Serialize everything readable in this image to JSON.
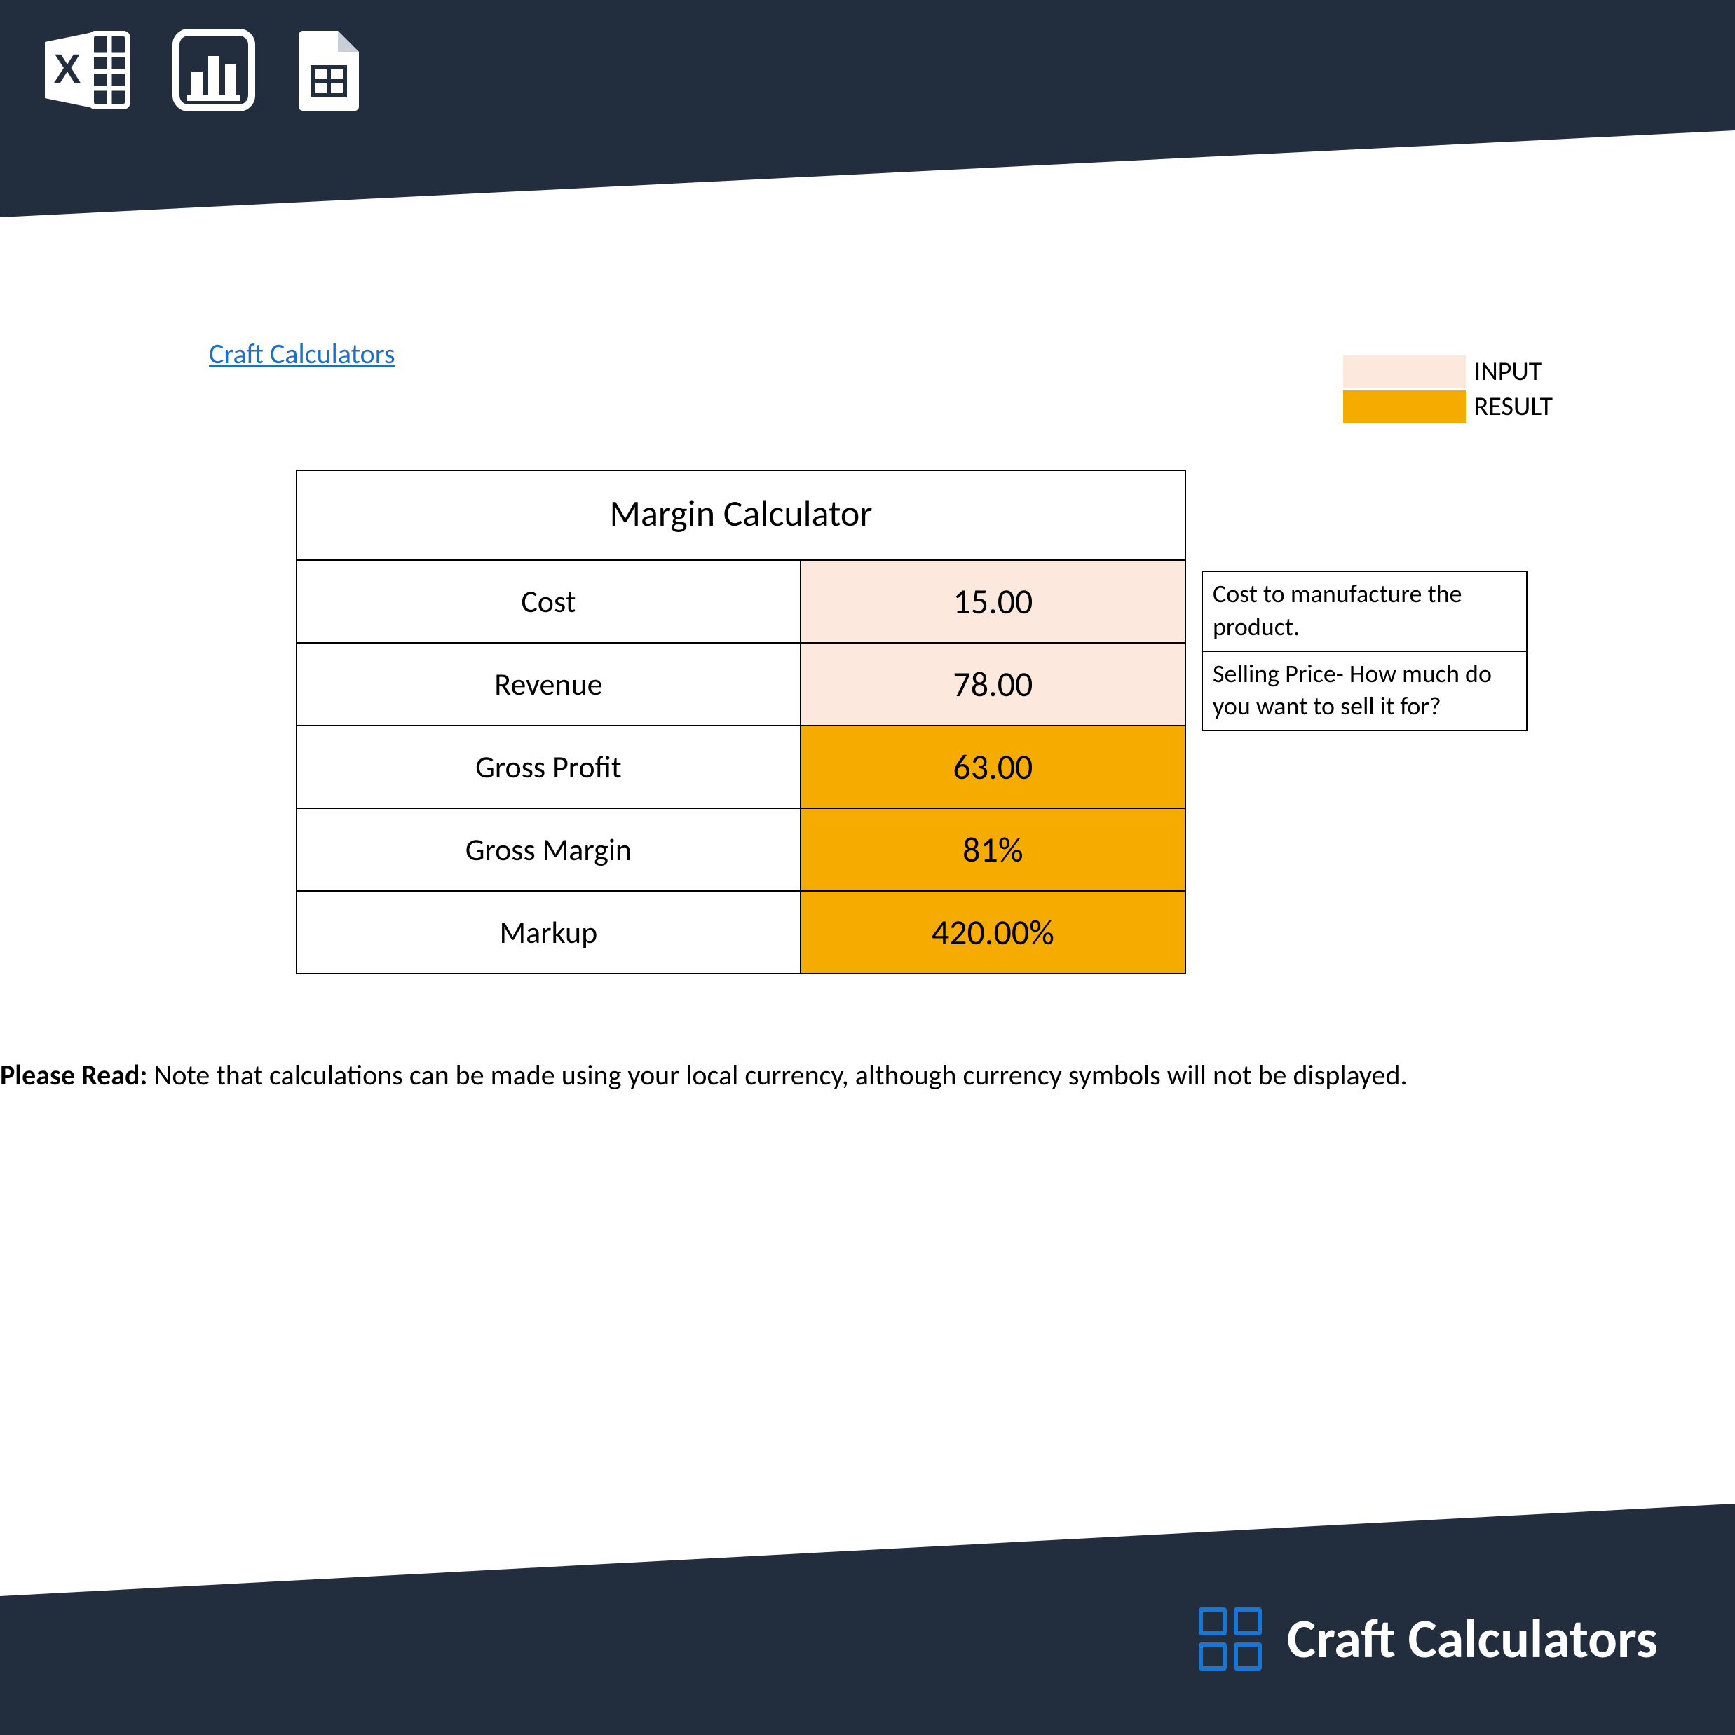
{
  "header": {
    "icons": [
      "excel-icon",
      "chart-icon",
      "sheets-icon"
    ]
  },
  "link": {
    "text": "Craft Calculators"
  },
  "legend": {
    "input_label": "INPUT",
    "result_label": "RESULT",
    "colors": {
      "input": "#fce8dd",
      "result": "#f6ab00"
    }
  },
  "calculator": {
    "title": "Margin Calculator",
    "rows": [
      {
        "label": "Cost",
        "value": "15.00",
        "type": "input"
      },
      {
        "label": "Revenue",
        "value": "78.00",
        "type": "input"
      },
      {
        "label": "Gross Profit",
        "value": "63.00",
        "type": "result"
      },
      {
        "label": "Gross Margin",
        "value": "81%",
        "type": "result"
      },
      {
        "label": "Markup",
        "value": "420.00%",
        "type": "result"
      }
    ]
  },
  "notes": [
    "Cost to manufacture the product.",
    "Selling Price- How much do you want to sell it for?"
  ],
  "footnote": {
    "lead": "Please Read:",
    "body": " Note that calculations can be made using your local currency, although currency symbols will not be displayed."
  },
  "footer": {
    "brand": "Craft Calculators"
  },
  "chart_data": {
    "type": "table",
    "title": "Margin Calculator",
    "inputs": {
      "Cost": 15.0,
      "Revenue": 78.0
    },
    "results": {
      "Gross Profit": 63.0,
      "Gross Margin": 0.81,
      "Markup": 4.2
    }
  }
}
